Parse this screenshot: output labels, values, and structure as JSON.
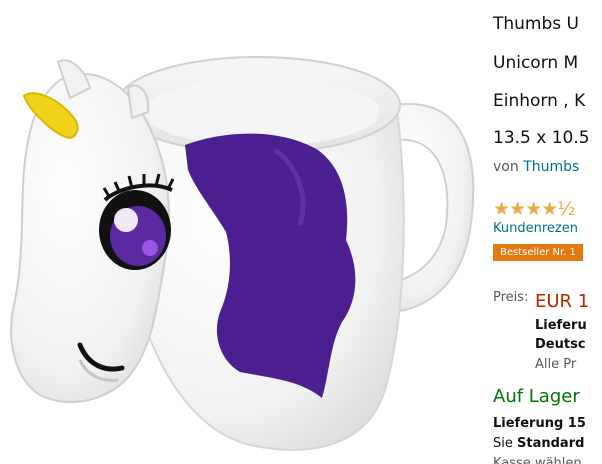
{
  "product": {
    "title_lines": [
      "Thumbs U",
      "Unicorn M",
      "Einhorn , K",
      "13.5 x 10.5"
    ],
    "by_prefix": "von",
    "brand_link": "Thumbs",
    "stars": "★★★★½",
    "reviews_link": "Kundenrezen",
    "badge": "Bestseller Nr. 1",
    "price_label": "Preis:",
    "price": "EUR 1",
    "shipping_line1": "Lieferu",
    "shipping_line2": "Deutsc",
    "shipping_line3": "Alle Pr",
    "stock": "Auf Lager",
    "delivery": "Lieferung 15",
    "standard_prefix": "Sie",
    "standard_bold": "Standard",
    "cutoff": "Kasse wählen"
  },
  "colors": {
    "link": "#007185",
    "price": "#b12704",
    "in_stock": "#007600",
    "badge": "#e47911",
    "stars": "#f3a847",
    "mane": "#4b1f8f",
    "horn": "#f2d21a"
  }
}
